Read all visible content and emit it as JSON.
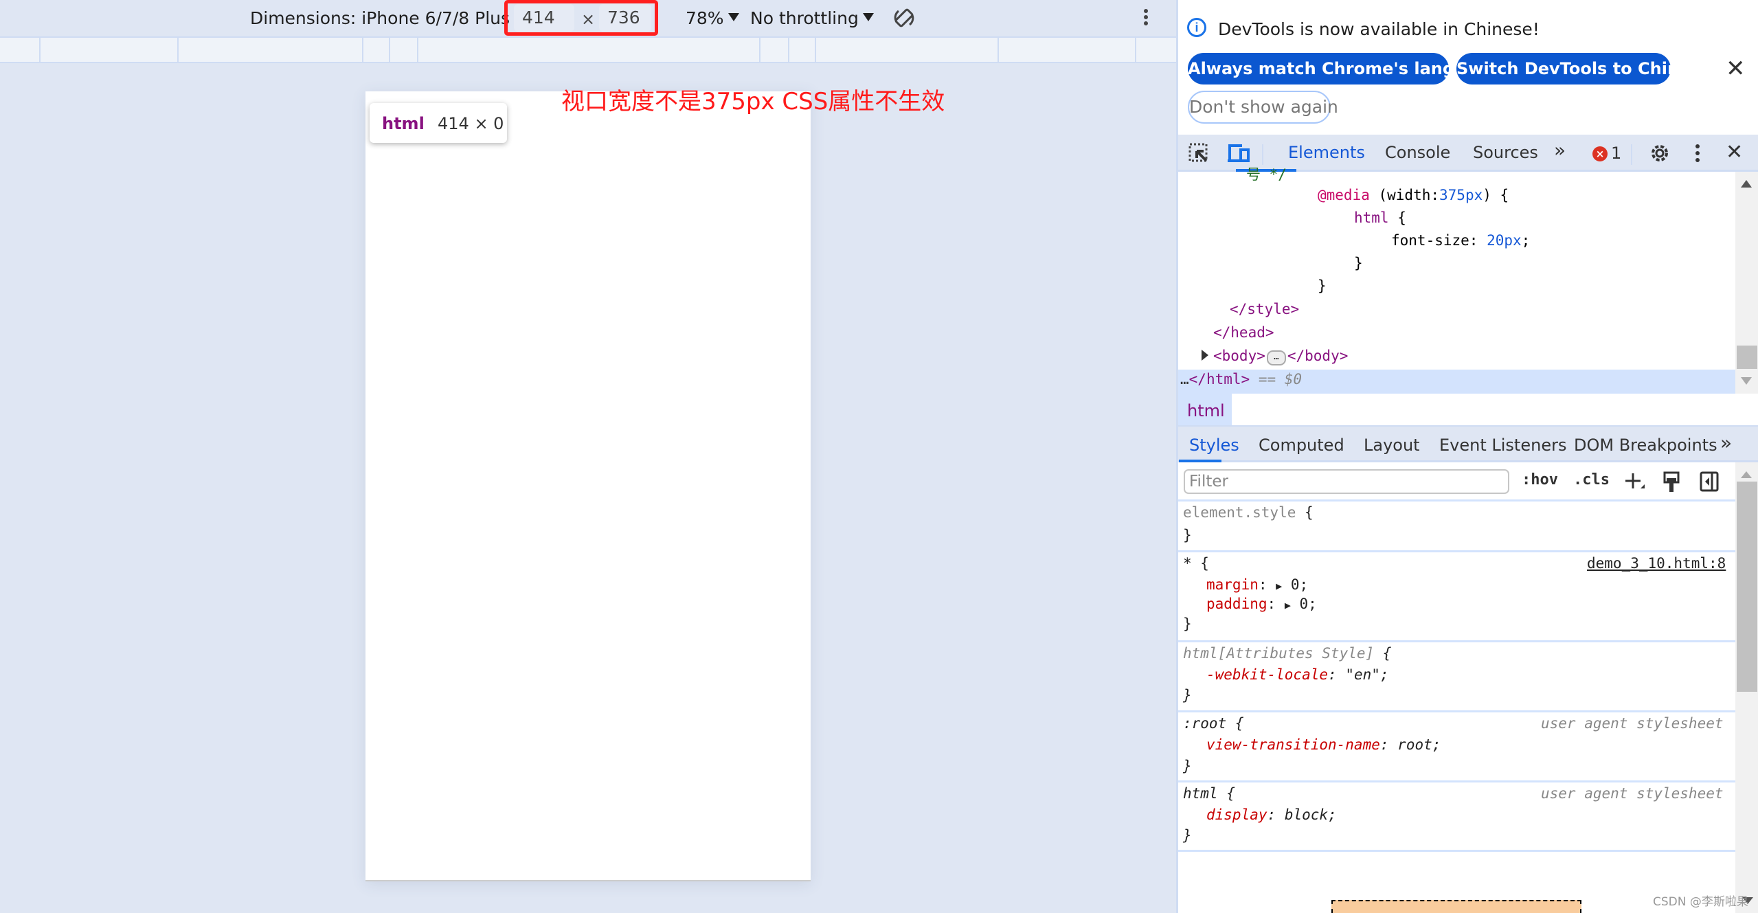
{
  "device_toolbar": {
    "dimensions_label": "Dimensions: iPhone 6/7/8 Plus",
    "width_value": "414",
    "times": "×",
    "height_value": "736",
    "zoom": "78%",
    "throttling": "No throttling",
    "rotate_icon": "rotate-icon",
    "more_icon": "more-vert-icon"
  },
  "viewport": {
    "tooltip_tag": "html",
    "tooltip_size": "414 × 0",
    "annotation": "视口宽度不是375px CSS属性不生效",
    "annotation_color": "#ff1a1a"
  },
  "infobar": {
    "message": "DevTools is now available in Chinese!",
    "btn_match": "Always match Chrome's language",
    "btn_switch": "Switch DevTools to Chinese",
    "btn_dont_show": "Don't show again",
    "close": "✕"
  },
  "main_tabs": {
    "items": [
      "Elements",
      "Console",
      "Sources"
    ],
    "active": "Elements",
    "more": "»",
    "error_count": "1",
    "close": "✕"
  },
  "elements": {
    "lines": [
      {
        "comment": "号 */"
      },
      {
        "media": "@media",
        "open": " (width:",
        "value": "375px",
        "close": ") {"
      },
      {
        "selector": "html",
        "brace": " {"
      },
      {
        "prop": "font-size",
        "colon": ": ",
        "value": "20px",
        "semi": ";"
      },
      {
        "text": "}"
      },
      {
        "text": "}"
      },
      {
        "tag": "</style>"
      },
      {
        "tag": "</head>"
      },
      {
        "open_tag": "<body>",
        "ellipsis": "…",
        "close_tag": "</body>"
      },
      {
        "tag": "</html>",
        "suffix": " == $0"
      }
    ]
  },
  "breadcrumb": {
    "item": "html"
  },
  "sub_tabs": {
    "items": [
      "Styles",
      "Computed",
      "Layout",
      "Event Listeners",
      "DOM Breakpoints"
    ],
    "active": "Styles",
    "more": "»"
  },
  "styles": {
    "filter_placeholder": "Filter",
    "hov": ":hov",
    "cls": ".cls",
    "rules": [
      {
        "selector": "element.style",
        "brace": " {",
        "props": [],
        "close": "}"
      },
      {
        "selector": "*",
        "brace": " {",
        "source": "demo_3_10.html:8",
        "props": [
          {
            "name": "margin",
            "value": "0"
          },
          {
            "name": "padding",
            "value": "0"
          }
        ],
        "close": "}"
      },
      {
        "selector": "html[Attributes Style]",
        "brace": " {",
        "props": [
          {
            "name": "-webkit-locale",
            "value": "\"en\""
          }
        ],
        "close": "}"
      },
      {
        "selector": ":root",
        "brace": " {",
        "source": "user agent stylesheet",
        "props": [
          {
            "name": "view-transition-name",
            "value": "root"
          }
        ],
        "close": "}"
      },
      {
        "selector": "html",
        "brace": " {",
        "source": "user agent stylesheet",
        "props": [
          {
            "name": "display",
            "value": "block"
          }
        ],
        "close": "}"
      }
    ]
  },
  "watermark": "CSDN @李斯啦果"
}
